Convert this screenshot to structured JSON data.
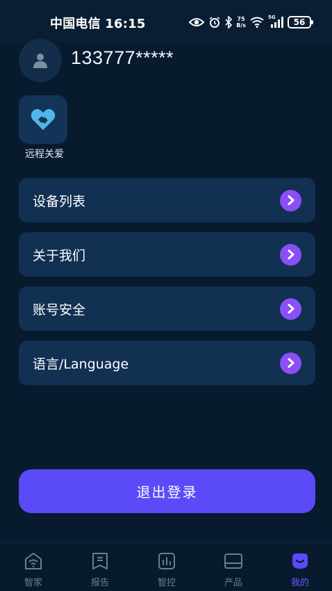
{
  "status_bar": {
    "carrier_time": "中国电信 16:15",
    "net_speed_value": "75",
    "net_speed_unit": "B/s",
    "signal_label": "5G",
    "battery": "56"
  },
  "profile": {
    "phone": "133777*****"
  },
  "remote_care": {
    "label": "远程关爱"
  },
  "menu": [
    {
      "label": "设备列表"
    },
    {
      "label": "关于我们"
    },
    {
      "label": "账号安全"
    },
    {
      "label": "语言/Language"
    }
  ],
  "logout": {
    "label": "退出登录"
  },
  "tabs": [
    {
      "label": "智家",
      "icon": "home-wifi-icon"
    },
    {
      "label": "报告",
      "icon": "report-icon"
    },
    {
      "label": "智控",
      "icon": "chart-icon"
    },
    {
      "label": "产品",
      "icon": "product-icon"
    },
    {
      "label": "我的",
      "icon": "smile-icon",
      "active": true
    }
  ],
  "colors": {
    "background": "#081a2e",
    "card": "#113052",
    "accent": "#5b4af7",
    "arrow": "#8a4ff5",
    "tab_active": "#6c5cff",
    "tab_inactive": "#6b7f93"
  }
}
